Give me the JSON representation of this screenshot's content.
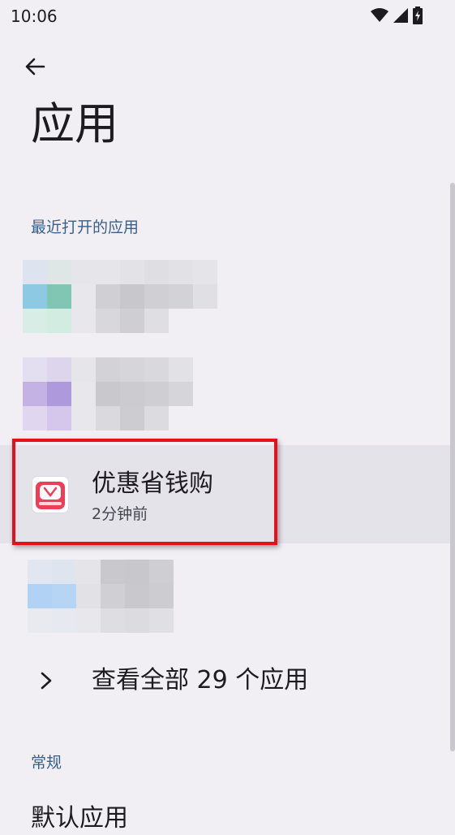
{
  "status_bar": {
    "time": "10:06"
  },
  "page": {
    "title": "应用"
  },
  "recent_section": {
    "label": "最近打开的应用",
    "highlighted_app": {
      "name": "优惠省钱购",
      "subtitle": "2分钟前"
    },
    "see_all_label": "查看全部 29 个应用"
  },
  "general_section": {
    "label": "常规",
    "first_item_partial": "默认应用"
  },
  "colors": {
    "highlight_border": "#e4111a",
    "section_label": "#3a5f8a",
    "background": "#f1eff4"
  }
}
